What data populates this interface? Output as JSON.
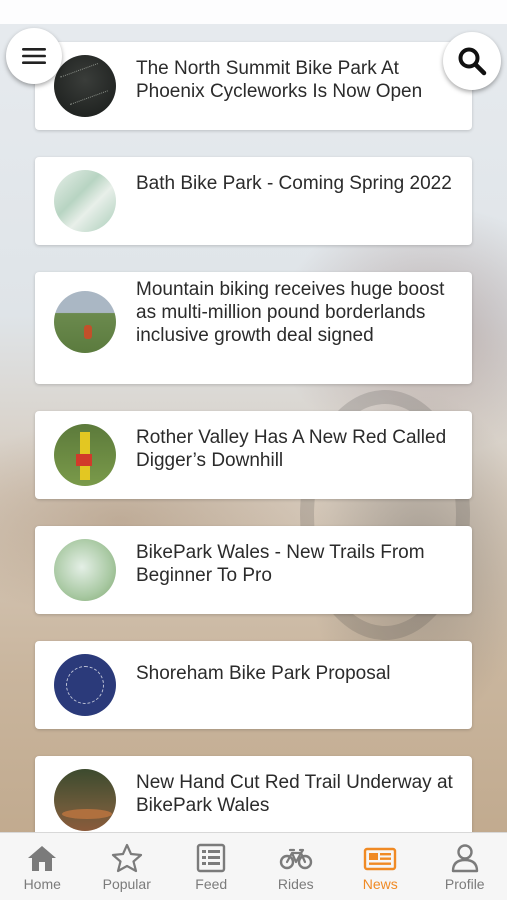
{
  "articles": [
    {
      "title": "The North Summit Bike Park At Phoenix Cycleworks Is Now Open"
    },
    {
      "title": "Bath Bike Park - Coming Spring 2022"
    },
    {
      "title": "Mountain biking receives huge boost as multi-million pound borderlands inclusive growth deal signed"
    },
    {
      "title": "Rother Valley Has A New Red Called Digger’s Downhill"
    },
    {
      "title": "BikePark Wales - New Trails From Beginner To Pro"
    },
    {
      "title": "Shoreham Bike Park Proposal"
    },
    {
      "title": "New Hand Cut Red Trail Underway at BikePark Wales"
    }
  ],
  "buttons": {
    "menu_icon": "hamburger-menu-icon",
    "search_icon": "search-icon"
  },
  "tabs": [
    {
      "label": "Home",
      "icon": "home-icon"
    },
    {
      "label": "Popular",
      "icon": "star-icon"
    },
    {
      "label": "Feed",
      "icon": "feed-icon"
    },
    {
      "label": "Rides",
      "icon": "bicycle-icon"
    },
    {
      "label": "News",
      "icon": "newspaper-icon",
      "active": true
    },
    {
      "label": "Profile",
      "icon": "profile-icon"
    }
  ],
  "colors": {
    "accent": "#f08a24",
    "inactive": "#7b7b7b",
    "card": "#ffffff",
    "text": "#2b2b2b"
  }
}
